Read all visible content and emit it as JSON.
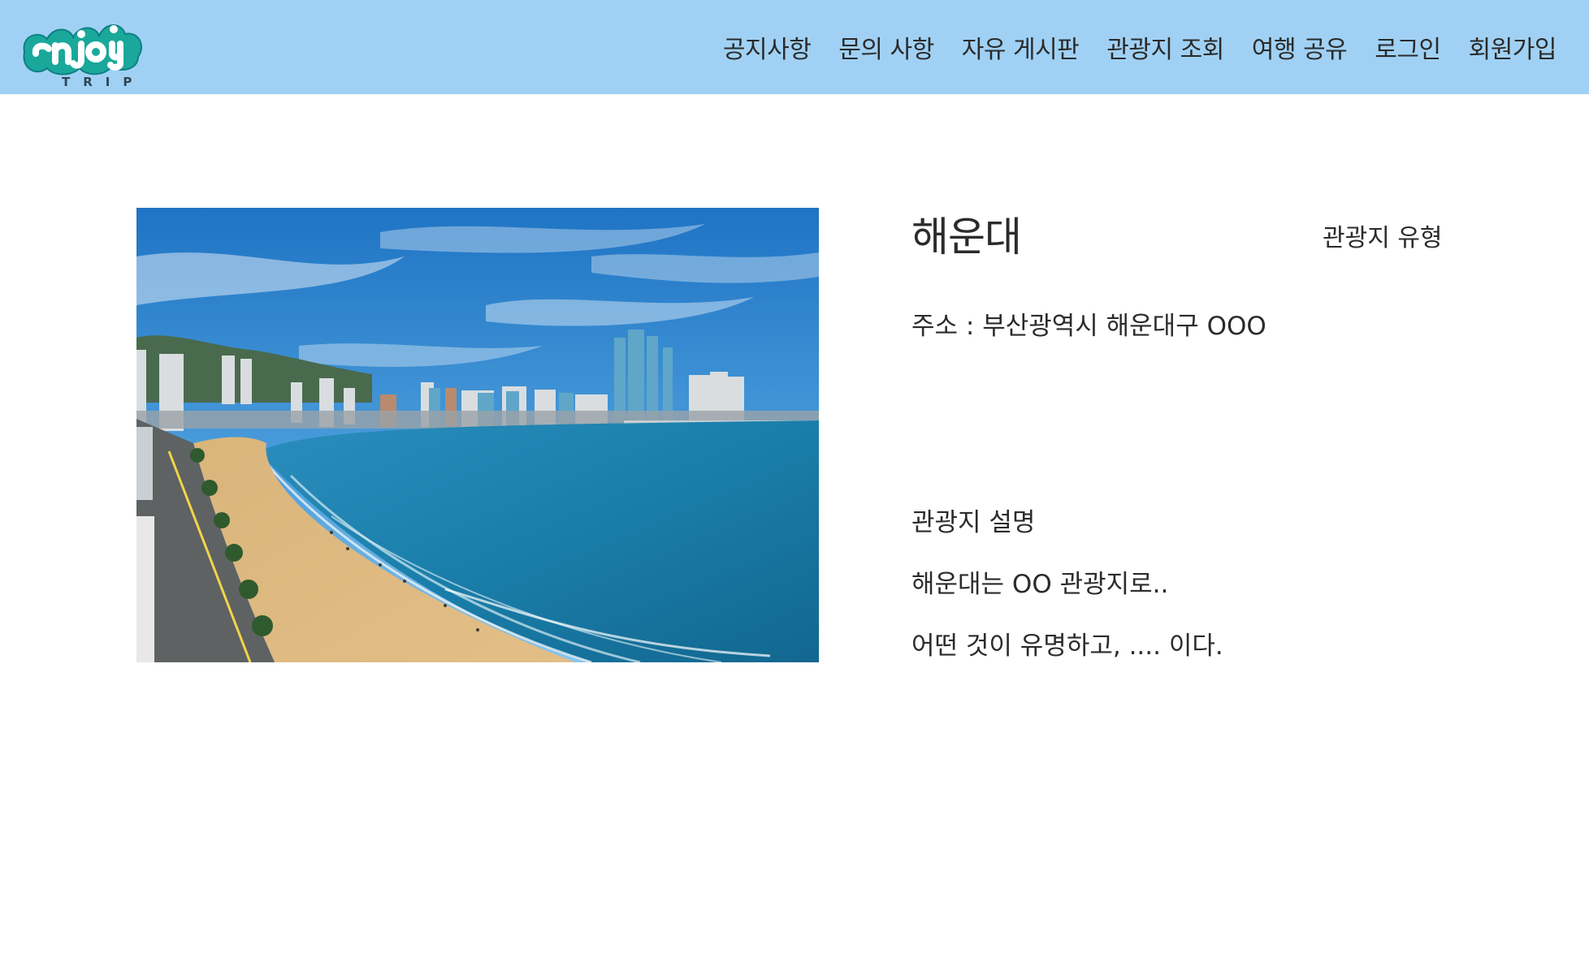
{
  "header": {
    "logo": {
      "word": "enjoy",
      "subtitle": "TRIP",
      "icon": "enjoy-trip-logo"
    },
    "nav": [
      {
        "label": "공지사항"
      },
      {
        "label": "문의 사항"
      },
      {
        "label": "자유 게시판"
      },
      {
        "label": "관광지 조회"
      },
      {
        "label": "여행 공유"
      },
      {
        "label": "로그인"
      },
      {
        "label": "회원가입"
      }
    ],
    "background_color": "#a0d1f4"
  },
  "attraction": {
    "photo_icon": "beach-photo",
    "name": "해운대",
    "type_label": "관광지 유형",
    "address": "주소 : 부산광역시 해운대구 OOO",
    "description_title": "관광지 설명",
    "description_lines": [
      "해운대는 OO 관광지로..",
      "어떤 것이 유명하고, .... 이다."
    ]
  }
}
